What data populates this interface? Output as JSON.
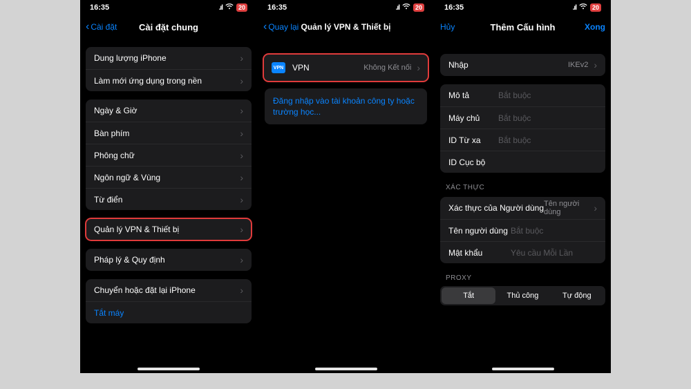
{
  "status": {
    "time": "16:35",
    "battery": "20"
  },
  "screen1": {
    "back": "Cài đặt",
    "title": "Cài đặt chung",
    "group_storage": [
      {
        "label": "Dung lượng iPhone"
      },
      {
        "label": "Làm mới ứng dụng trong nền"
      }
    ],
    "group_region": [
      {
        "label": "Ngày & Giờ"
      },
      {
        "label": "Bàn phím"
      },
      {
        "label": "Phông chữ"
      },
      {
        "label": "Ngôn ngữ & Vùng"
      },
      {
        "label": "Từ điển"
      }
    ],
    "vpn_row": "Quản lý VPN & Thiết bị",
    "legal_row": "Pháp lý & Quy định",
    "group_reset": {
      "transfer": "Chuyển hoặc đặt lại iPhone",
      "shutdown": "Tắt máy"
    }
  },
  "screen2": {
    "back": "Quay lại",
    "title": "Quản lý VPN & Thiết bị",
    "vpn_badge": "VPN",
    "vpn_label": "VPN",
    "vpn_status": "Không Kết nối",
    "signin_link": "Đăng nhập vào tài khoản công ty hoặc trường học..."
  },
  "screen3": {
    "cancel": "Hủy",
    "title": "Thêm Cấu hình",
    "done": "Xong",
    "type_row": {
      "label": "Nhập",
      "value": "IKEv2"
    },
    "fields": {
      "desc": {
        "label": "Mô tả",
        "placeholder": "Bắt buộc"
      },
      "server": {
        "label": "Máy chủ",
        "placeholder": "Bắt buộc"
      },
      "remoteid": {
        "label": "ID Từ xa",
        "placeholder": "Bắt buộc"
      },
      "localid": {
        "label": "ID Cục bộ",
        "placeholder": ""
      }
    },
    "auth_header": "XÁC THỰC",
    "auth_row": {
      "label": "Xác thực của Người dùng",
      "value": "Tên người dùng"
    },
    "username": {
      "label": "Tên người dùng",
      "placeholder": "Bắt buộc"
    },
    "password": {
      "label": "Mật khẩu",
      "placeholder": "Yêu cầu Mỗi Lần"
    },
    "proxy_header": "PROXY",
    "proxy_options": [
      "Tắt",
      "Thủ công",
      "Tự động"
    ]
  }
}
